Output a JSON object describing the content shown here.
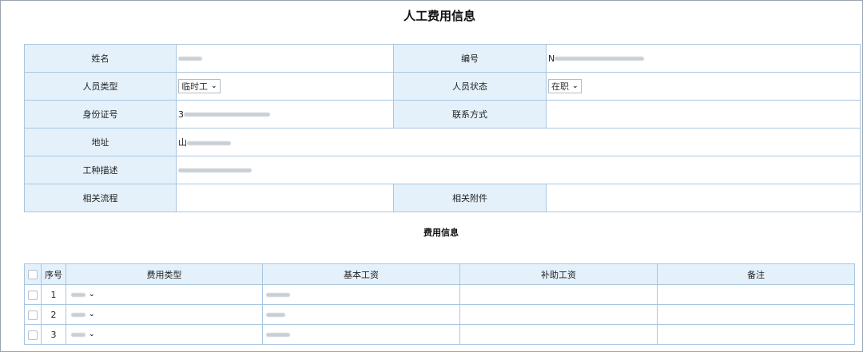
{
  "page_title": "人工费用信息",
  "info": {
    "name_label": "姓名",
    "number_label": "编号",
    "number_prefix": "N",
    "type_label": "人员类型",
    "type_value": "临时工",
    "status_label": "人员状态",
    "status_value": "在职",
    "id_label": "身份证号",
    "id_prefix": "3",
    "contact_label": "联系方式",
    "address_label": "地址",
    "address_prefix": "山",
    "job_label": "工种描述",
    "process_label": "相关流程",
    "attachment_label": "相关附件"
  },
  "fee_section_title": "费用信息",
  "fee_table": {
    "headers": [
      "序号",
      "费用类型",
      "基本工资",
      "补助工资",
      "备注"
    ],
    "rows": [
      {
        "no": "1"
      },
      {
        "no": "2"
      },
      {
        "no": "3"
      }
    ]
  },
  "icons": {
    "dropdown": "chevron-down-icon",
    "checkbox": "checkbox-icon"
  }
}
